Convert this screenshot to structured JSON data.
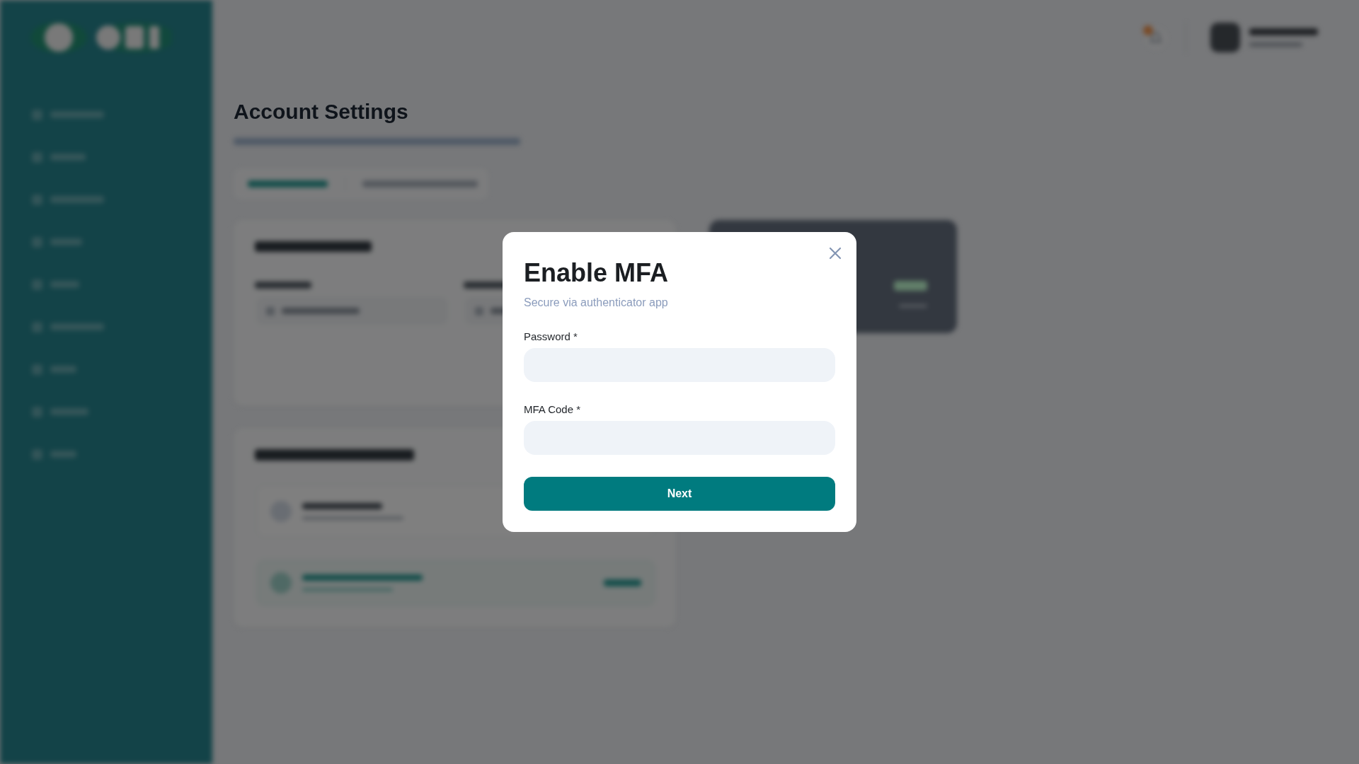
{
  "background": {
    "page_title": "Account Settings"
  },
  "dialog": {
    "title": "Enable MFA",
    "subtitle": "Secure via authenticator app",
    "fields": [
      {
        "label": "Password *"
      },
      {
        "label": "MFA Code *"
      }
    ],
    "submit": "Next"
  }
}
